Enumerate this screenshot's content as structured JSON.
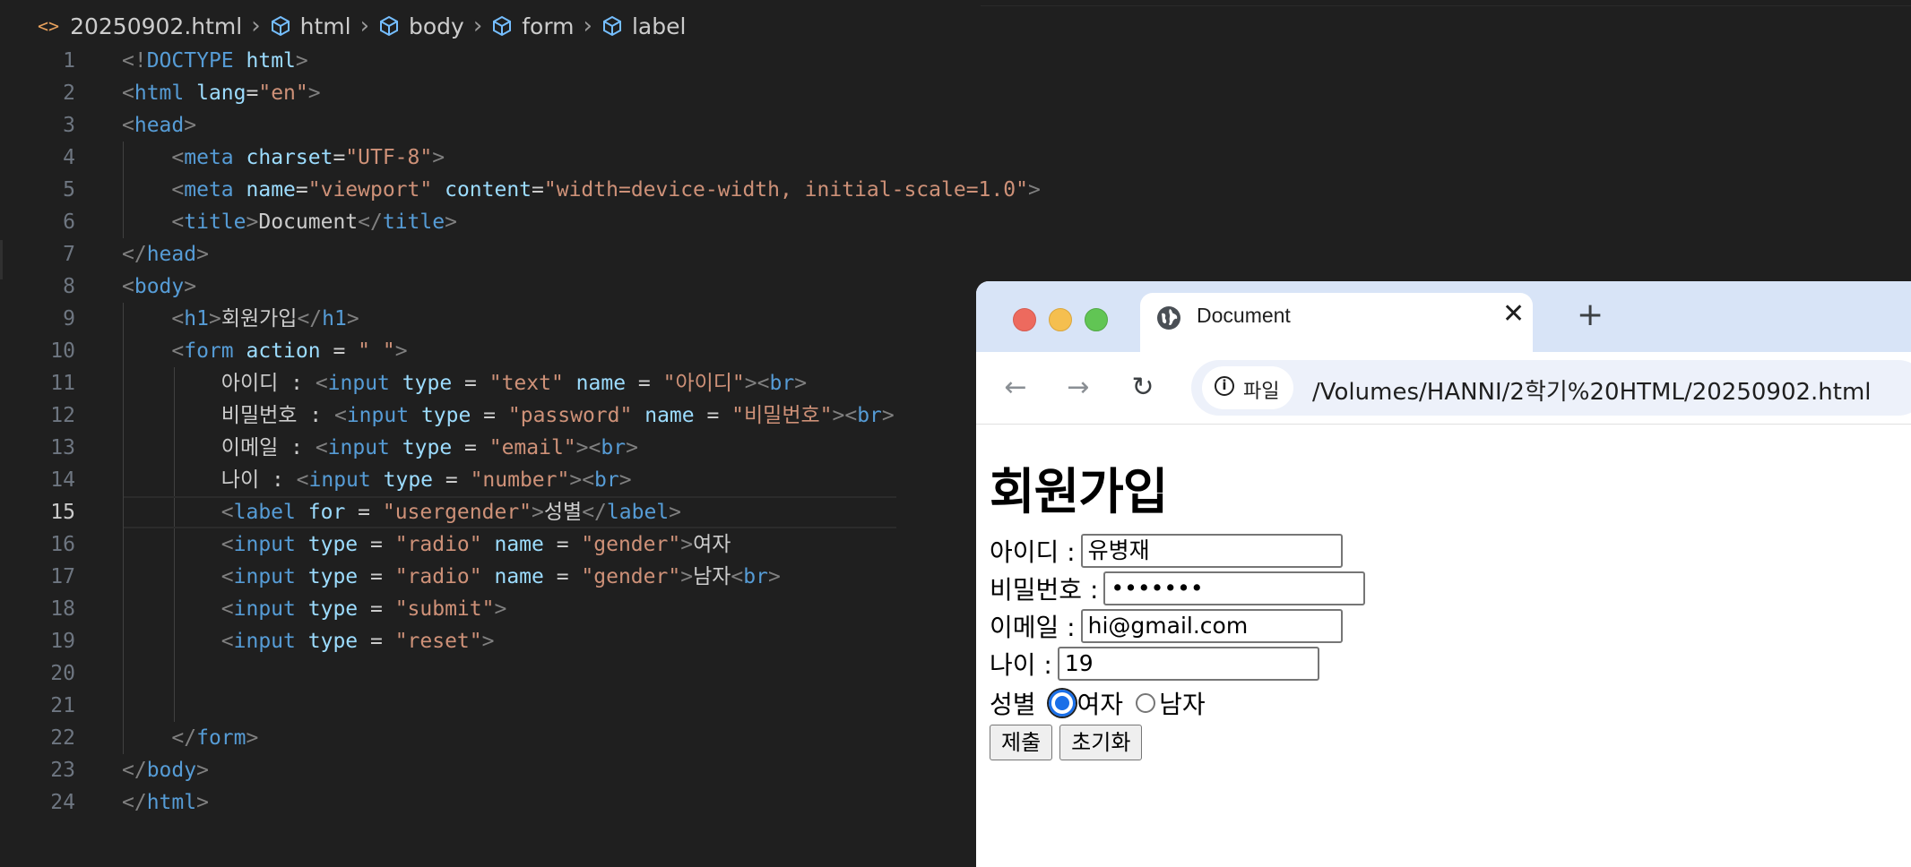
{
  "breadcrumb": {
    "file": "20250902.html",
    "path": [
      "html",
      "body",
      "form",
      "label"
    ]
  },
  "editor": {
    "current_line": 15,
    "lines": [
      {
        "n": "1",
        "tokens": [
          [
            "br",
            "<!"
          ],
          [
            "tag",
            "DOCTYPE"
          ],
          [
            "op",
            " "
          ],
          [
            "attr",
            "html"
          ],
          [
            "br",
            ">"
          ]
        ],
        "indent": 0
      },
      {
        "n": "2",
        "tokens": [
          [
            "br",
            "<"
          ],
          [
            "tag",
            "html"
          ],
          [
            "op",
            " "
          ],
          [
            "attr",
            "lang"
          ],
          [
            "op",
            "="
          ],
          [
            "str",
            "\"en\""
          ],
          [
            "br",
            ">"
          ]
        ],
        "indent": 0
      },
      {
        "n": "3",
        "tokens": [
          [
            "br",
            "<"
          ],
          [
            "tag",
            "head"
          ],
          [
            "br",
            ">"
          ]
        ],
        "indent": 0
      },
      {
        "n": "4",
        "tokens": [
          [
            "op",
            "    "
          ],
          [
            "br",
            "<"
          ],
          [
            "tag",
            "meta"
          ],
          [
            "op",
            " "
          ],
          [
            "attr",
            "charset"
          ],
          [
            "op",
            "="
          ],
          [
            "str",
            "\"UTF-8\""
          ],
          [
            "br",
            ">"
          ]
        ],
        "indent": 1
      },
      {
        "n": "5",
        "tokens": [
          [
            "op",
            "    "
          ],
          [
            "br",
            "<"
          ],
          [
            "tag",
            "meta"
          ],
          [
            "op",
            " "
          ],
          [
            "attr",
            "name"
          ],
          [
            "op",
            "="
          ],
          [
            "str",
            "\"viewport\""
          ],
          [
            "op",
            " "
          ],
          [
            "attr",
            "content"
          ],
          [
            "op",
            "="
          ],
          [
            "str",
            "\"width=device-width, initial-scale=1.0\""
          ],
          [
            "br",
            ">"
          ]
        ],
        "indent": 1
      },
      {
        "n": "6",
        "tokens": [
          [
            "op",
            "    "
          ],
          [
            "br",
            "<"
          ],
          [
            "tag",
            "title"
          ],
          [
            "br",
            ">"
          ],
          [
            "text",
            "Document"
          ],
          [
            "br",
            "</"
          ],
          [
            "tag",
            "title"
          ],
          [
            "br",
            ">"
          ]
        ],
        "indent": 1
      },
      {
        "n": "7",
        "tokens": [
          [
            "br",
            "</"
          ],
          [
            "tag",
            "head"
          ],
          [
            "br",
            ">"
          ]
        ],
        "indent": 0
      },
      {
        "n": "8",
        "tokens": [
          [
            "br",
            "<"
          ],
          [
            "tag",
            "body"
          ],
          [
            "br",
            ">"
          ]
        ],
        "indent": 0
      },
      {
        "n": "9",
        "tokens": [
          [
            "op",
            "    "
          ],
          [
            "br",
            "<"
          ],
          [
            "tag",
            "h1"
          ],
          [
            "br",
            ">"
          ],
          [
            "text",
            "회원가입"
          ],
          [
            "br",
            "</"
          ],
          [
            "tag",
            "h1"
          ],
          [
            "br",
            ">"
          ]
        ],
        "indent": 1
      },
      {
        "n": "10",
        "tokens": [
          [
            "op",
            "    "
          ],
          [
            "br",
            "<"
          ],
          [
            "tag",
            "form"
          ],
          [
            "op",
            " "
          ],
          [
            "attr",
            "action"
          ],
          [
            "op",
            " = "
          ],
          [
            "str",
            "\" \""
          ],
          [
            "br",
            ">"
          ]
        ],
        "indent": 1
      },
      {
        "n": "11",
        "tokens": [
          [
            "op",
            "        "
          ],
          [
            "text",
            "아이디 : "
          ],
          [
            "br",
            "<"
          ],
          [
            "tag",
            "input"
          ],
          [
            "op",
            " "
          ],
          [
            "attr",
            "type"
          ],
          [
            "op",
            " = "
          ],
          [
            "str",
            "\"text\""
          ],
          [
            "op",
            " "
          ],
          [
            "attr",
            "name"
          ],
          [
            "op",
            " = "
          ],
          [
            "str",
            "\"아이디\""
          ],
          [
            "br",
            "><"
          ],
          [
            "tag",
            "br"
          ],
          [
            "br",
            ">"
          ]
        ],
        "indent": 2
      },
      {
        "n": "12",
        "tokens": [
          [
            "op",
            "        "
          ],
          [
            "text",
            "비밀번호 : "
          ],
          [
            "br",
            "<"
          ],
          [
            "tag",
            "input"
          ],
          [
            "op",
            " "
          ],
          [
            "attr",
            "type"
          ],
          [
            "op",
            " = "
          ],
          [
            "str",
            "\"password\""
          ],
          [
            "op",
            " "
          ],
          [
            "attr",
            "name"
          ],
          [
            "op",
            " = "
          ],
          [
            "str",
            "\"비밀번호\""
          ],
          [
            "br",
            "><"
          ],
          [
            "tag",
            "br"
          ],
          [
            "br",
            ">"
          ]
        ],
        "indent": 2
      },
      {
        "n": "13",
        "tokens": [
          [
            "op",
            "        "
          ],
          [
            "text",
            "이메일 : "
          ],
          [
            "br",
            "<"
          ],
          [
            "tag",
            "input"
          ],
          [
            "op",
            " "
          ],
          [
            "attr",
            "type"
          ],
          [
            "op",
            " = "
          ],
          [
            "str",
            "\"email\""
          ],
          [
            "br",
            "><"
          ],
          [
            "tag",
            "br"
          ],
          [
            "br",
            ">"
          ]
        ],
        "indent": 2
      },
      {
        "n": "14",
        "tokens": [
          [
            "op",
            "        "
          ],
          [
            "text",
            "나이 : "
          ],
          [
            "br",
            "<"
          ],
          [
            "tag",
            "input"
          ],
          [
            "op",
            " "
          ],
          [
            "attr",
            "type"
          ],
          [
            "op",
            " = "
          ],
          [
            "str",
            "\"number\""
          ],
          [
            "br",
            "><"
          ],
          [
            "tag",
            "br"
          ],
          [
            "br",
            ">"
          ]
        ],
        "indent": 2
      },
      {
        "n": "15",
        "tokens": [
          [
            "op",
            "        "
          ],
          [
            "br",
            "<"
          ],
          [
            "tag",
            "label"
          ],
          [
            "op",
            " "
          ],
          [
            "attr",
            "for"
          ],
          [
            "op",
            " = "
          ],
          [
            "str",
            "\"usergender\""
          ],
          [
            "br",
            ">"
          ],
          [
            "text",
            "성별"
          ],
          [
            "br",
            "</"
          ],
          [
            "tag",
            "label"
          ],
          [
            "br",
            ">"
          ]
        ],
        "indent": 2
      },
      {
        "n": "16",
        "tokens": [
          [
            "op",
            "        "
          ],
          [
            "br",
            "<"
          ],
          [
            "tag",
            "input"
          ],
          [
            "op",
            " "
          ],
          [
            "attr",
            "type"
          ],
          [
            "op",
            " = "
          ],
          [
            "str",
            "\"radio\""
          ],
          [
            "op",
            " "
          ],
          [
            "attr",
            "name"
          ],
          [
            "op",
            " = "
          ],
          [
            "str",
            "\"gender\""
          ],
          [
            "br",
            ">"
          ],
          [
            "text",
            "여자"
          ]
        ],
        "indent": 2
      },
      {
        "n": "17",
        "tokens": [
          [
            "op",
            "        "
          ],
          [
            "br",
            "<"
          ],
          [
            "tag",
            "input"
          ],
          [
            "op",
            " "
          ],
          [
            "attr",
            "type"
          ],
          [
            "op",
            " = "
          ],
          [
            "str",
            "\"radio\""
          ],
          [
            "op",
            " "
          ],
          [
            "attr",
            "name"
          ],
          [
            "op",
            " = "
          ],
          [
            "str",
            "\"gender\""
          ],
          [
            "br",
            ">"
          ],
          [
            "text",
            "남자"
          ],
          [
            "br",
            "<"
          ],
          [
            "tag",
            "br"
          ],
          [
            "br",
            ">"
          ]
        ],
        "indent": 2
      },
      {
        "n": "18",
        "tokens": [
          [
            "op",
            "        "
          ],
          [
            "br",
            "<"
          ],
          [
            "tag",
            "input"
          ],
          [
            "op",
            " "
          ],
          [
            "attr",
            "type"
          ],
          [
            "op",
            " = "
          ],
          [
            "str",
            "\"submit\""
          ],
          [
            "br",
            ">"
          ]
        ],
        "indent": 2
      },
      {
        "n": "19",
        "tokens": [
          [
            "op",
            "        "
          ],
          [
            "br",
            "<"
          ],
          [
            "tag",
            "input"
          ],
          [
            "op",
            " "
          ],
          [
            "attr",
            "type"
          ],
          [
            "op",
            " = "
          ],
          [
            "str",
            "\"reset\""
          ],
          [
            "br",
            ">"
          ]
        ],
        "indent": 2
      },
      {
        "n": "20",
        "tokens": [],
        "indent": 2
      },
      {
        "n": "21",
        "tokens": [],
        "indent": 2
      },
      {
        "n": "22",
        "tokens": [
          [
            "op",
            "    "
          ],
          [
            "br",
            "</"
          ],
          [
            "tag",
            "form"
          ],
          [
            "br",
            ">"
          ]
        ],
        "indent": 1
      },
      {
        "n": "23",
        "tokens": [
          [
            "br",
            "</"
          ],
          [
            "tag",
            "body"
          ],
          [
            "br",
            ">"
          ]
        ],
        "indent": 0
      },
      {
        "n": "24",
        "tokens": [
          [
            "br",
            "</"
          ],
          [
            "tag",
            "html"
          ],
          [
            "br",
            ">"
          ]
        ],
        "indent": 0
      }
    ]
  },
  "browser": {
    "tab_title": "Document",
    "tab_close": "✕",
    "new_tab": "+",
    "chip_label": "파일",
    "url": "/Volumes/HANNI/2학기%20HTML/20250902.html",
    "page": {
      "heading": "회원가입",
      "fields": [
        {
          "label": "아이디 :",
          "value": "유병재"
        },
        {
          "label": "비밀번호 :",
          "value": "•••••••"
        },
        {
          "label": "이메일 :",
          "value": "hi@gmail.com"
        },
        {
          "label": "나이 :",
          "value": "19"
        }
      ],
      "gender_label": "성별",
      "radio_female": "여자",
      "radio_male": "남자",
      "submit": "제출",
      "reset": "초기화"
    }
  }
}
